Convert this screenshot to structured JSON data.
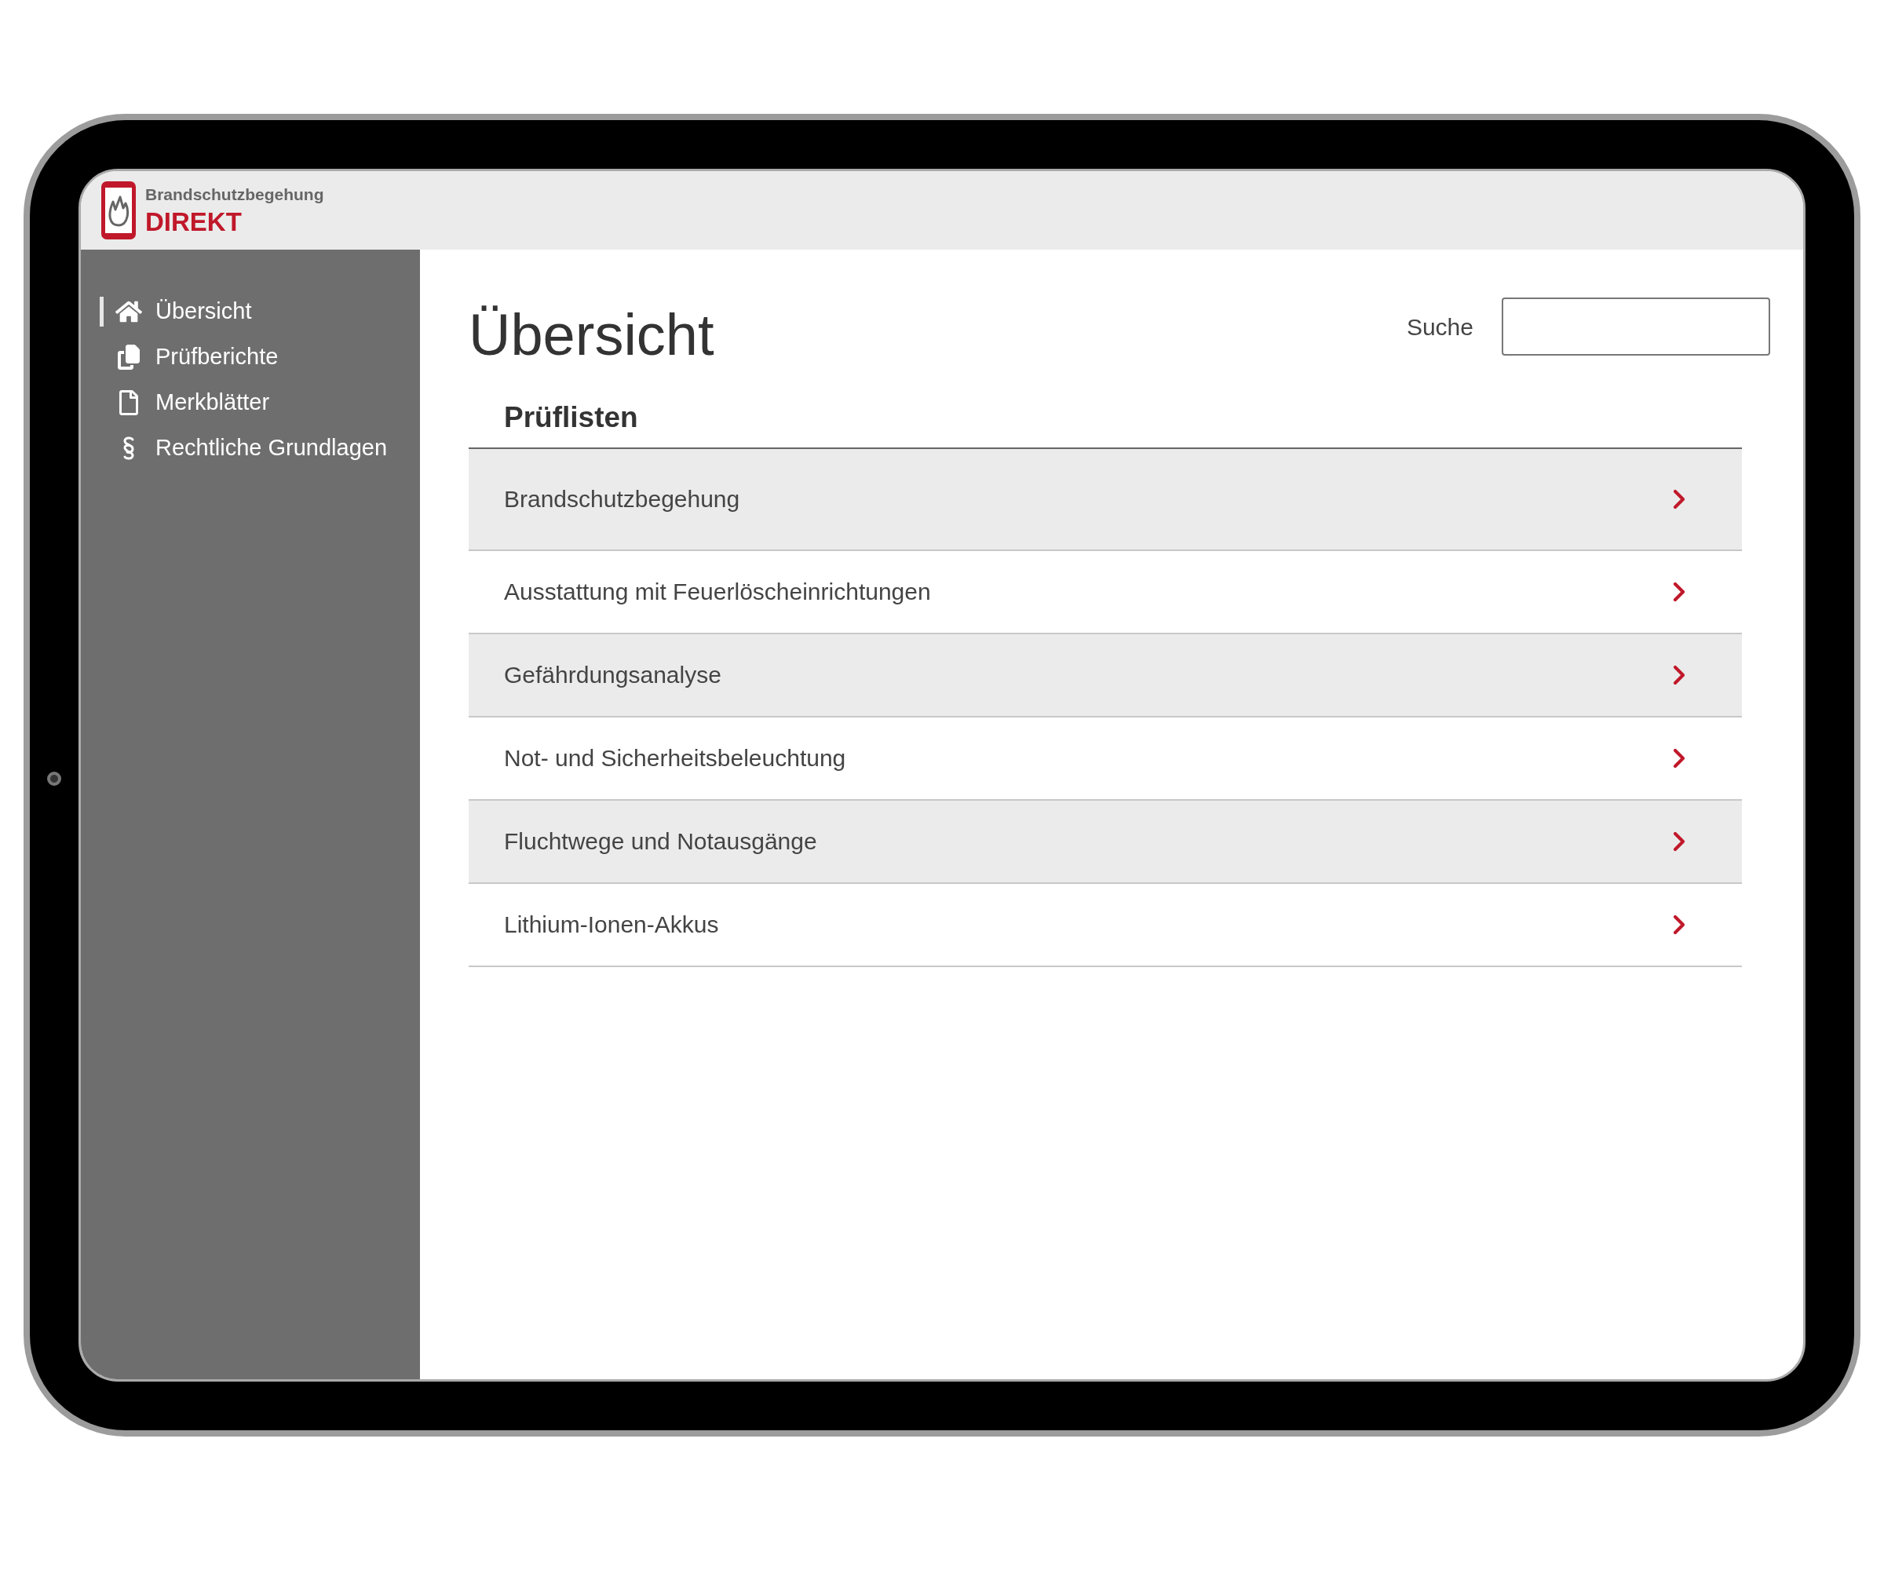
{
  "app": {
    "brand_top": "Brandschutzbegehung",
    "brand_name": "DIREKT"
  },
  "sidebar": {
    "items": [
      {
        "label": "Übersicht",
        "selected": true
      },
      {
        "label": "Prüfberichte",
        "selected": false
      },
      {
        "label": "Merkblätter",
        "selected": false
      },
      {
        "label": "Rechtliche Grundlagen",
        "selected": false
      }
    ]
  },
  "page": {
    "title": "Übersicht",
    "search_label": "Suche"
  },
  "section": {
    "title": "Prüflisten",
    "rows": [
      {
        "label": "Brandschutzbegehung"
      },
      {
        "label": "Ausstattung mit Feuerlöscheinrichtungen"
      },
      {
        "label": "Gefährdungsanalyse"
      },
      {
        "label": "Not- und Sicherheitsbeleuchtung"
      },
      {
        "label": "Fluchtwege und Notausgänge"
      },
      {
        "label": "Lithium-Ionen-Akkus"
      }
    ]
  }
}
